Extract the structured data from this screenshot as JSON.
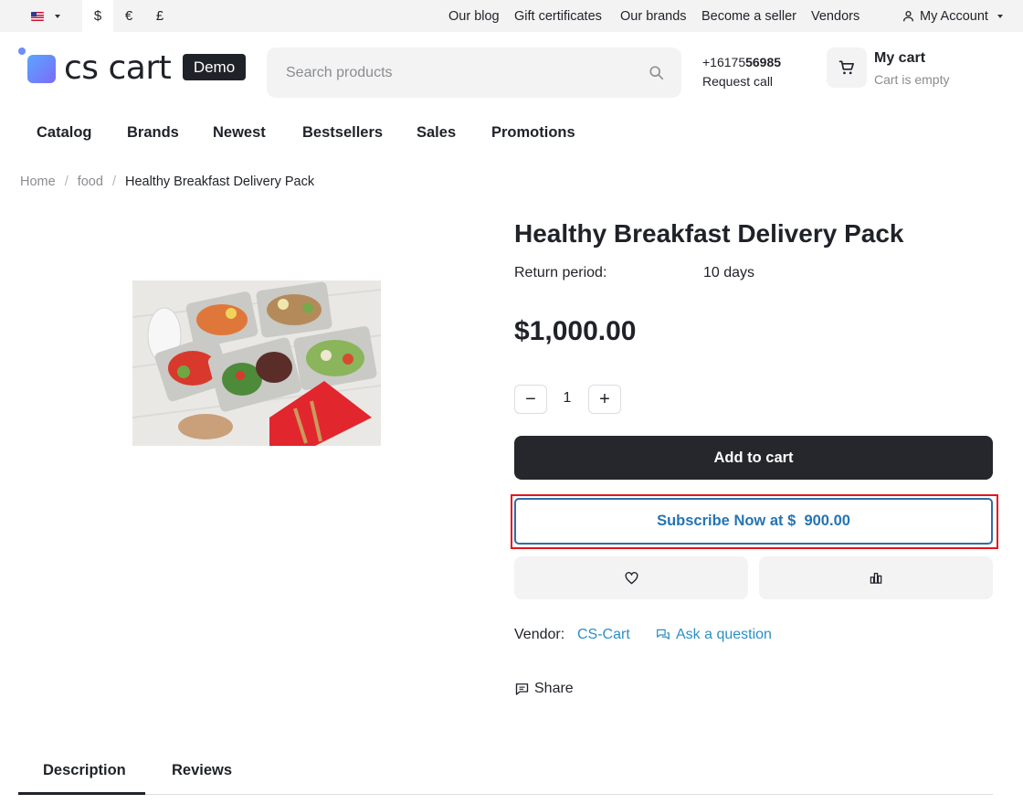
{
  "topbar": {
    "language": {
      "icon": "us-flag-icon"
    },
    "currencies": [
      "$",
      "€",
      "£"
    ],
    "links": [
      "Our blog",
      "Gift certificates",
      "Our brands",
      "Become a seller",
      "Vendors"
    ],
    "account_label": "My Account"
  },
  "header": {
    "logo_text": "cs cart",
    "logo_badge": "Demo",
    "search_placeholder": "Search products",
    "phone_prefix": "+16175",
    "phone_bold": "56985",
    "request_call": "Request call",
    "cart_title": "My cart",
    "cart_status": "Cart is empty"
  },
  "nav": [
    "Catalog",
    "Brands",
    "Newest",
    "Bestsellers",
    "Sales",
    "Promotions"
  ],
  "breadcrumb": {
    "items": [
      "Home",
      "food"
    ],
    "current": "Healthy Breakfast Delivery Pack",
    "separator": "/"
  },
  "product": {
    "title": "Healthy Breakfast Delivery Pack",
    "return_label": "Return period:",
    "return_value": "10 days",
    "price": "$1,000.00",
    "quantity": "1",
    "minus": "−",
    "plus": "+",
    "add_to_cart": "Add to cart",
    "subscribe": "Subscribe Now at $  900.00",
    "wishlist_icon": "heart-icon",
    "compare_icon": "compare-icon",
    "vendor_label": "Vendor:",
    "vendor_name": "CS-Cart",
    "ask_question": "Ask a question",
    "share": "Share"
  },
  "tabs": [
    "Description",
    "Reviews"
  ],
  "colors": {
    "accent_link": "#2c8fc4",
    "subscribe_border": "#2e6ea8",
    "highlight": "#e5141f",
    "dark_button": "#25272c"
  }
}
